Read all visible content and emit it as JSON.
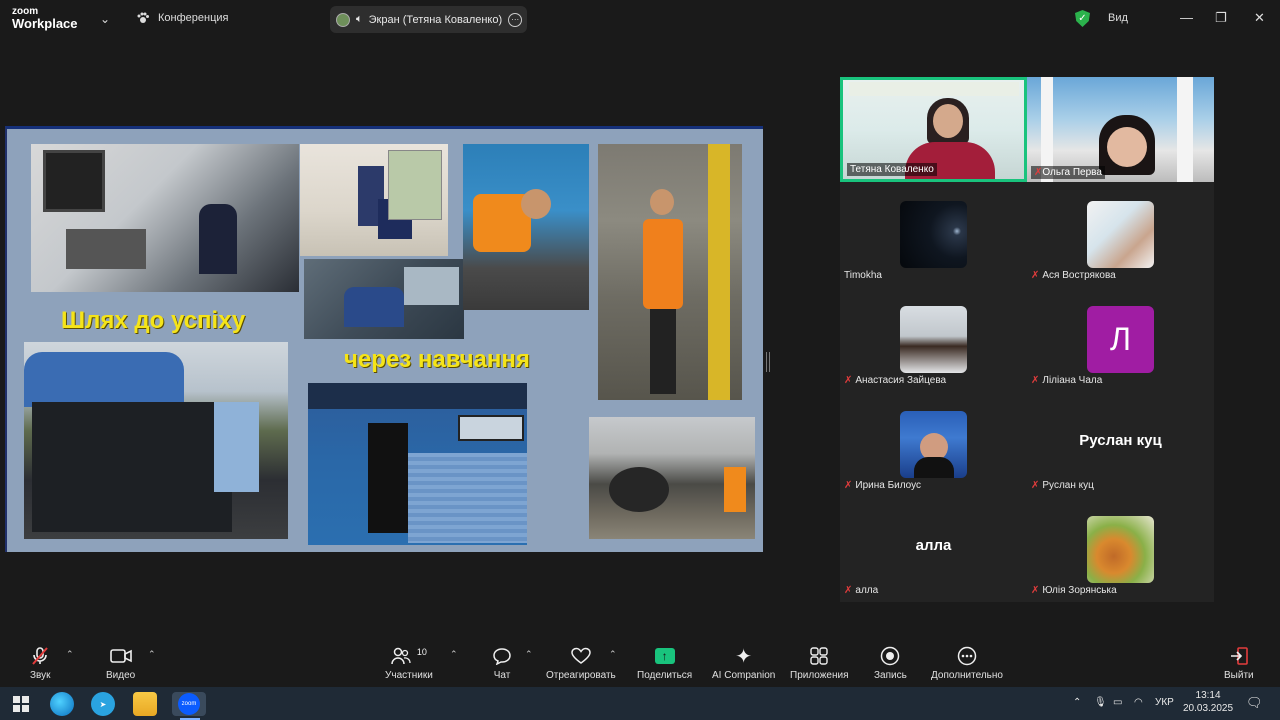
{
  "titlebar": {
    "brand_line1": "zoom",
    "brand_line2": "Workplace",
    "conference_label": "Конференция",
    "screen_label": "Экран (Тетяна  Коваленко)",
    "view_label": "Вид"
  },
  "slide": {
    "text1": "Шлях до  успіху",
    "text2": "через навчання"
  },
  "gallery": {
    "video_tiles": [
      {
        "name": "Тетяна  Коваленко",
        "muted": false
      },
      {
        "name": "Ольга Перва",
        "muted": true
      }
    ],
    "tiles": [
      {
        "name": "Timokha",
        "muted": false,
        "thumb": "photo",
        "big_label": ""
      },
      {
        "name": "Ася Вострякова",
        "muted": true,
        "thumb": "photo",
        "big_label": ""
      },
      {
        "name": "Анастасия Зайцева",
        "muted": true,
        "thumb": "photo",
        "big_label": ""
      },
      {
        "name": "Ліліана Чала",
        "muted": true,
        "thumb": "letter",
        "letter": "Л",
        "big_label": ""
      },
      {
        "name": "Ирина Билоус",
        "muted": true,
        "thumb": "photo",
        "big_label": ""
      },
      {
        "name": "Руслан куц",
        "muted": true,
        "thumb": "none",
        "big_label": "Руслан куц"
      },
      {
        "name": "алла",
        "muted": true,
        "thumb": "none",
        "big_label": "алла"
      },
      {
        "name": "Юлія Зорянська",
        "muted": true,
        "thumb": "photo",
        "big_label": ""
      }
    ]
  },
  "toolbar": {
    "audio": "Звук",
    "video": "Видео",
    "participants": "Участники",
    "participants_count": "10",
    "chat": "Чат",
    "react": "Отреагировать",
    "share": "Поделиться",
    "ai": "AI Companion",
    "apps": "Приложения",
    "record": "Запись",
    "more": "Дополнительно",
    "leave": "Выйти"
  },
  "taskbar": {
    "zoom_label": "zoom",
    "lang": "УКР",
    "time": "13:14",
    "date": "20.03.2025"
  },
  "colors": {
    "accent_green": "#19c37d",
    "mute_red": "#e23c3c",
    "slide_bg": "#8ea2bb",
    "slide_text": "#f5e419"
  }
}
